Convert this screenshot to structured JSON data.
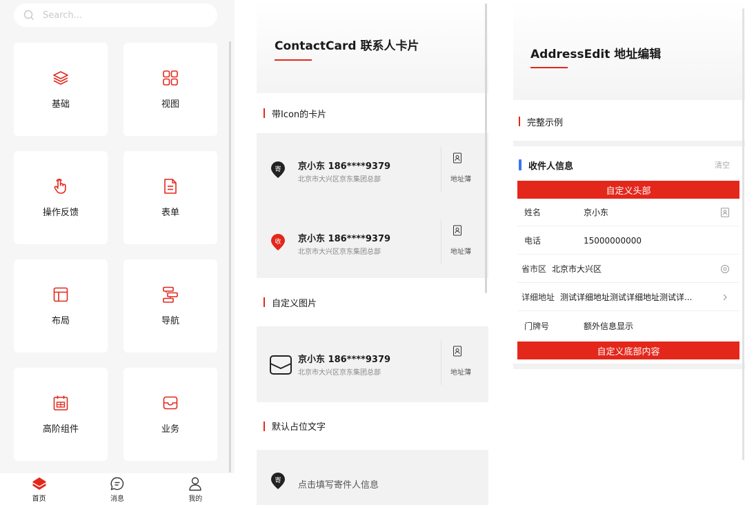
{
  "left": {
    "search_placeholder": "Search...",
    "tiles": [
      {
        "label": "基础",
        "icon": "layers-icon"
      },
      {
        "label": "视图",
        "icon": "grid-icon"
      },
      {
        "label": "操作反馈",
        "icon": "pointer-hand-icon"
      },
      {
        "label": "表单",
        "icon": "document-icon"
      },
      {
        "label": "布局",
        "icon": "layout-icon"
      },
      {
        "label": "导航",
        "icon": "navigation-icon"
      },
      {
        "label": "高阶组件",
        "icon": "calendar-icon"
      },
      {
        "label": "业务",
        "icon": "box-icon"
      }
    ],
    "tabbar": [
      {
        "label": "首页",
        "icon": "home-icon",
        "active": true
      },
      {
        "label": "消息",
        "icon": "message-icon",
        "active": false
      },
      {
        "label": "我的",
        "icon": "user-icon",
        "active": false
      }
    ],
    "accent": "#e4271b"
  },
  "middle": {
    "title": "ContactCard 联系人卡片",
    "sections": [
      {
        "title": "带Icon的卡片"
      },
      {
        "title": "自定义图片"
      },
      {
        "title": "默认占位文字"
      }
    ],
    "cards": [
      {
        "badge": "寄",
        "badge_color": "#222222",
        "name": "京小东  186****9379",
        "address": "北京市大兴区京东集团总部",
        "book_label": "地址薄"
      },
      {
        "badge": "收",
        "badge_color": "#e4271b",
        "name": "京小东  186****9379",
        "address": "北京市大兴区京东集团总部",
        "book_label": "地址薄"
      },
      {
        "badge": "",
        "badge_color": "#222222",
        "name": "京小东  186****9379",
        "address": "北京市大兴区京东集团总部",
        "book_label": "地址薄"
      }
    ],
    "placeholder": {
      "badge": "寄",
      "text": "点击填写寄件人信息"
    }
  },
  "right": {
    "title": "AddressEdit 地址编辑",
    "section_title": "完整示例",
    "receiver_title": "收件人信息",
    "clear_label": "清空",
    "custom_header": "自定义头部",
    "custom_footer": "自定义底部内容",
    "fields": [
      {
        "label": "姓名",
        "value": "京小东",
        "icon": "contacts-book-icon"
      },
      {
        "label": "电话",
        "value": "15000000000",
        "icon": ""
      },
      {
        "label": "省市区",
        "value": "北京市大兴区",
        "icon": "location-icon"
      },
      {
        "label": "详细地址",
        "value": "测试详细地址测试详细地址测试详...",
        "icon": "chevron-right-icon"
      },
      {
        "label": "门牌号",
        "value": "额外信息显示",
        "icon": ""
      }
    ]
  }
}
